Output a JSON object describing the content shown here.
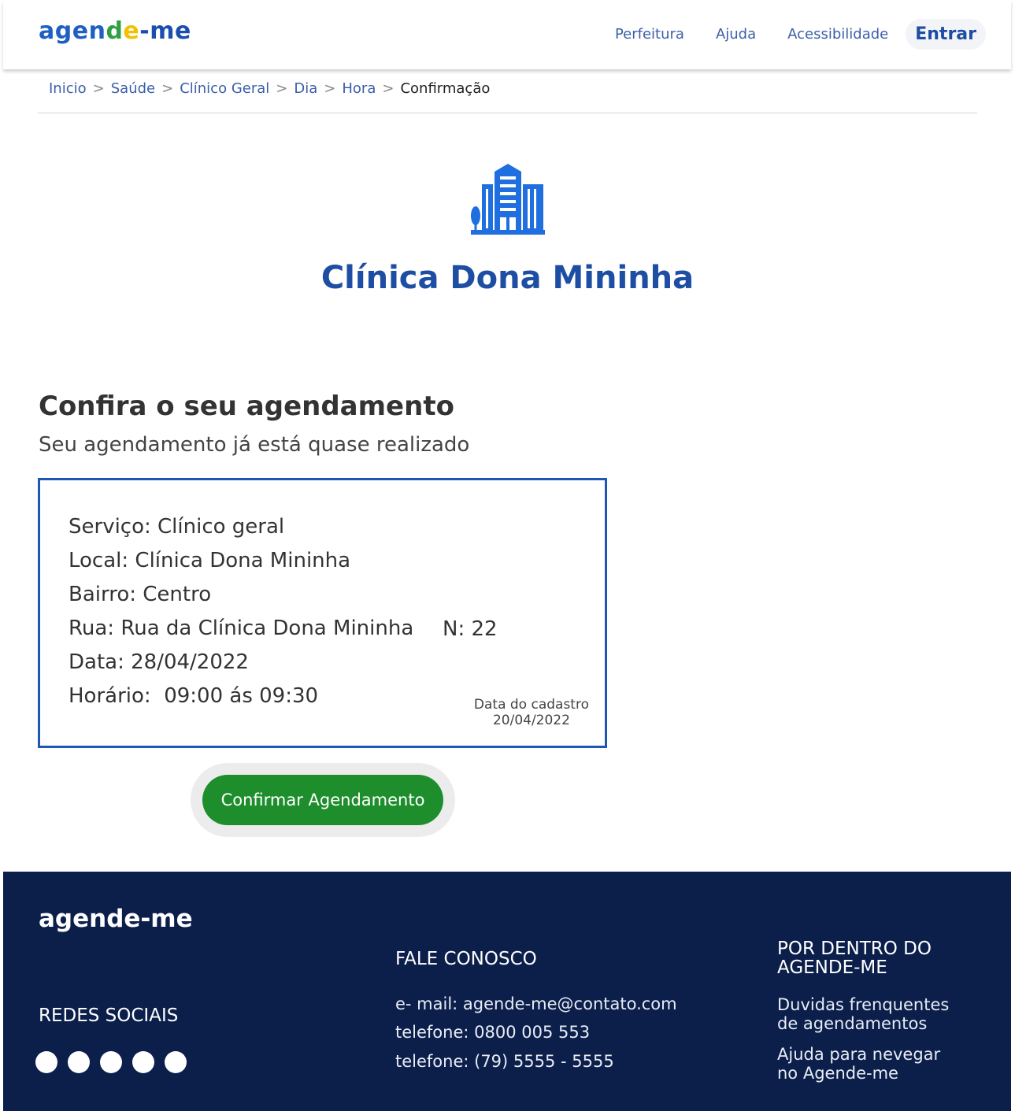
{
  "header": {
    "logo": {
      "part1": "agen",
      "part2": "d",
      "part3": "e",
      "part4": "-me"
    },
    "nav": [
      "Perfeitura",
      "Ajuda",
      "Acessibilidade"
    ],
    "login": "Entrar"
  },
  "breadcrumb": {
    "items": [
      "Inicio",
      "Saúde",
      "Clínico Geral",
      "Dia",
      "Hora"
    ],
    "current": "Confirmação",
    "separator": ">"
  },
  "clinic": {
    "icon": "building-icon",
    "name": "Clínica Dona Mininha"
  },
  "confirm": {
    "title": "Confira o seu agendamento",
    "subtitle": "Seu agendamento já está quase realizado"
  },
  "booking": {
    "servico": "Serviço: Clínico geral",
    "local": "Local: Clínica Dona Mininha",
    "bairro": "Bairro: Centro",
    "rua": "Rua: Rua da Clínica Dona Mininha",
    "numero": "N: 22",
    "data": "Data: 28/04/2022",
    "horario": "Horário:  09:00 ás 09:30",
    "cadastro_label": "Data do cadastro",
    "cadastro_data": "20/04/2022"
  },
  "actions": {
    "confirm_button": "Confirmar Agendamento"
  },
  "footer": {
    "logo": "agende-me",
    "social_title": "REDES SOCIAIS",
    "contact_title": "FALE CONOSCO",
    "email": "e- mail: agende-me@contato.com",
    "phone1": "telefone: 0800 005 553",
    "phone2": "telefone: (79) 5555 - 5555",
    "about_title": "POR DENTRO DO AGENDE-ME",
    "faq": "Duvidas frenquentes de agendamentos",
    "help": "Ajuda para nevegar no Agende-me"
  },
  "colors": {
    "primary": "#1d4ea3",
    "confirm_button": "#1e8e2d",
    "footer_bg": "#0c1f4b"
  }
}
